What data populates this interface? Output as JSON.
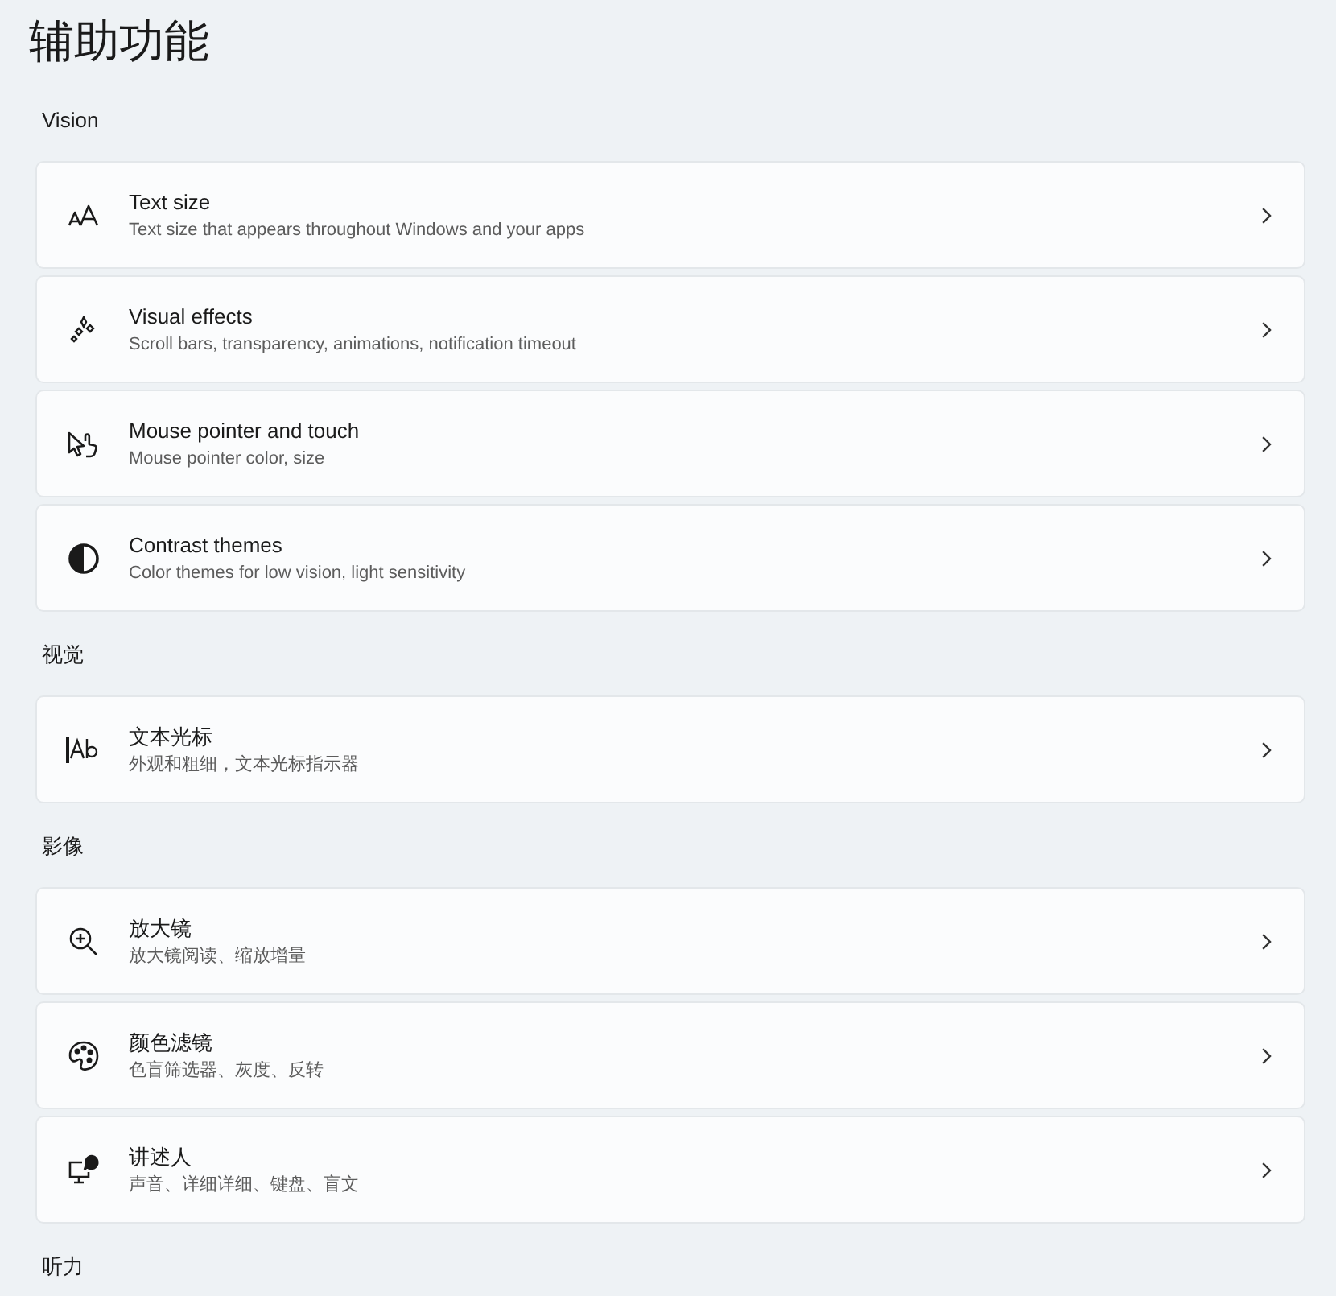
{
  "page": {
    "title": "辅助功能"
  },
  "sections": [
    {
      "label": "Vision",
      "items": [
        {
          "kind": "textsize",
          "title": "Text size",
          "subtitle": "Text size that appears throughout Windows and your apps"
        },
        {
          "kind": "effects",
          "title": "Visual effects",
          "subtitle": "Scroll bars, transparency, animations, notification timeout"
        },
        {
          "kind": "pointer",
          "title": "Mouse pointer and touch",
          "subtitle": "Mouse pointer color, size"
        },
        {
          "kind": "contrast",
          "title": "Contrast themes",
          "subtitle": "Color themes for low vision, light sensitivity"
        }
      ]
    },
    {
      "label": "视觉",
      "items": [
        {
          "kind": "cursor",
          "title": "文本光标",
          "subtitle": "外观和粗细，文本光标指示器"
        }
      ]
    },
    {
      "label": "影像",
      "items": [
        {
          "kind": "magnifier",
          "title": "放大镜",
          "subtitle": "放大镜阅读、缩放增量"
        },
        {
          "kind": "filters",
          "title": "颜色滤镜",
          "subtitle": "色盲筛选器、灰度、反转"
        },
        {
          "kind": "narrator",
          "title": "讲述人",
          "subtitle": "声音、详细详细、键盘、盲文"
        }
      ]
    },
    {
      "label": "听力"
    }
  ]
}
